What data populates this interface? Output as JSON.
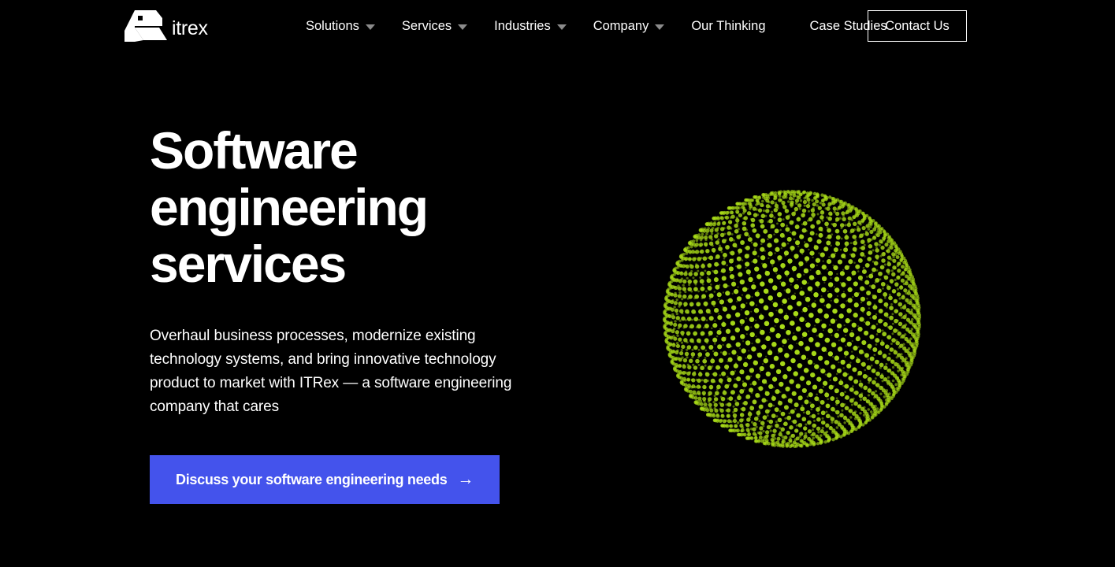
{
  "theme": {
    "background": "#000000",
    "accent_blue": "#4453ec",
    "accent_green": "#a9dc18",
    "text": "#ffffff",
    "caret_gray": "#8b8b8b"
  },
  "header": {
    "logo": {
      "icon": "itrex-r-logo-icon",
      "wordmark": "itrex"
    },
    "nav_items": [
      {
        "label": "Solutions",
        "has_dropdown": true
      },
      {
        "label": "Services",
        "has_dropdown": true
      },
      {
        "label": "Industries",
        "has_dropdown": true
      },
      {
        "label": "Company",
        "has_dropdown": true
      },
      {
        "label": "Our Thinking",
        "has_dropdown": false
      },
      {
        "label": "Case Studies",
        "has_dropdown": false
      }
    ],
    "contact_button": "Contact Us"
  },
  "hero": {
    "title_lines": [
      "Software",
      "engineering",
      "services"
    ],
    "subtitle": "Overhaul business processes, modernize existing technology systems, and bring innovative technology product to market with ITRex — a software engineering company that cares",
    "cta": {
      "label": "Discuss your software engineering needs",
      "arrow": "→"
    },
    "graphic": {
      "name": "dot-sphere-graphic",
      "color": "#a9dc18"
    }
  }
}
